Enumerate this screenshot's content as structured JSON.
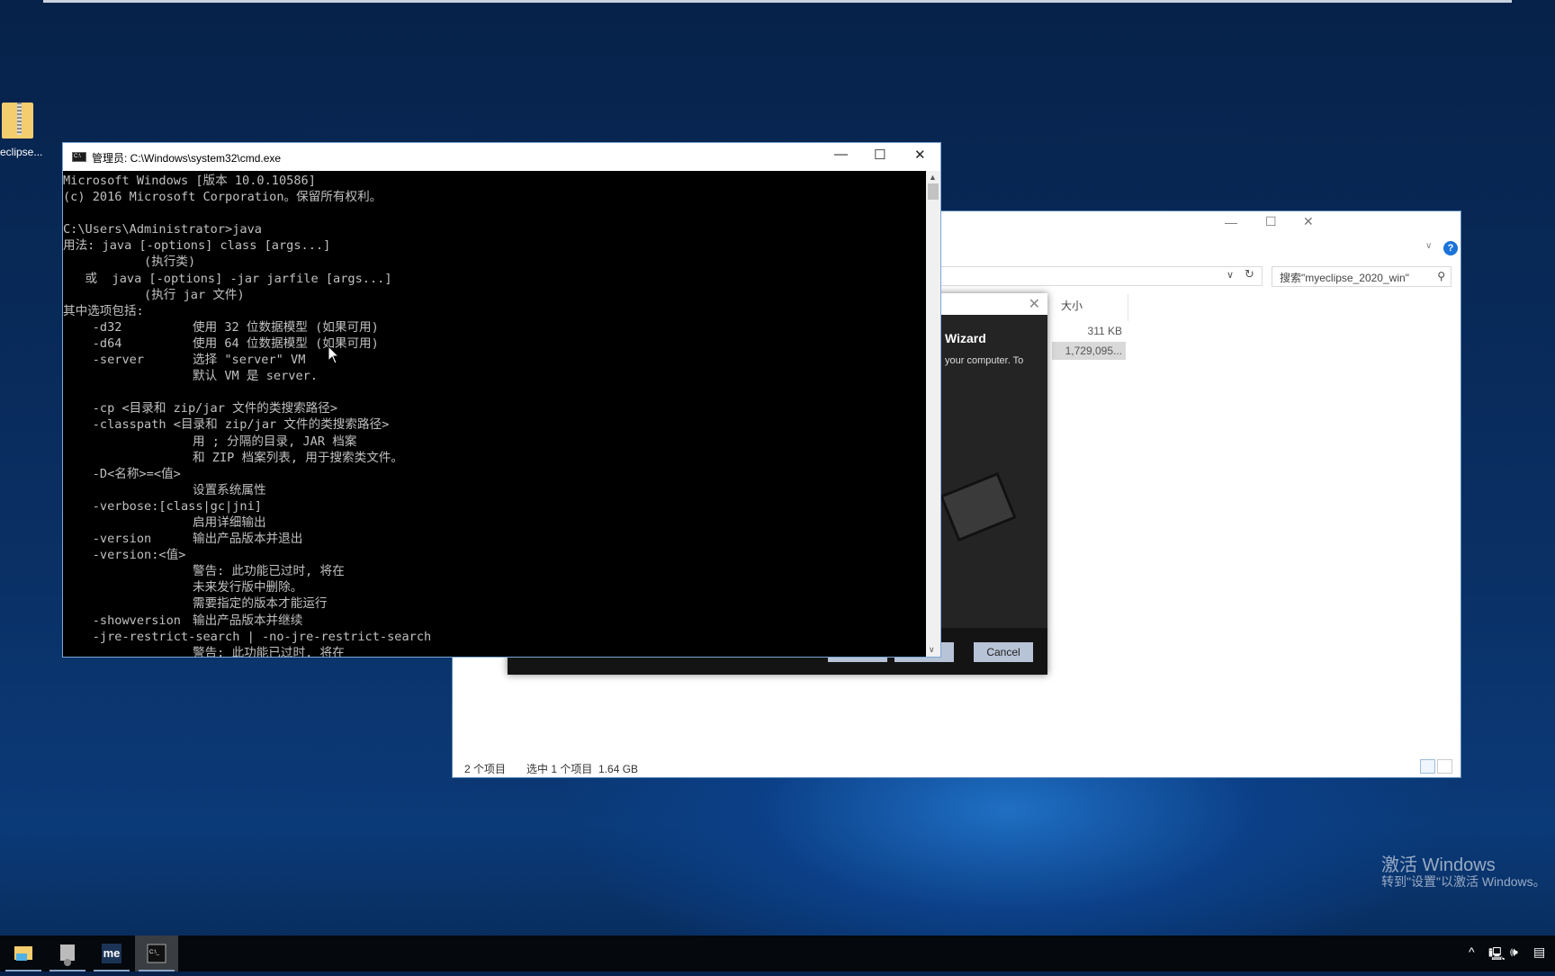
{
  "desktop": {
    "icon_label": "eclipse..."
  },
  "explorer": {
    "search_placeholder": "搜索\"myeclipse_2020_win\"",
    "column_size": "大小",
    "rows": [
      {
        "size": "311 KB"
      },
      {
        "size": "1,729,095..."
      }
    ],
    "status_count": "2 个项目",
    "status_selected": "选中 1 个项目  1.64 GB",
    "help": "?"
  },
  "installer": {
    "heading": "Wizard",
    "text": "your computer. To",
    "cancel": "Cancel"
  },
  "cmd": {
    "title": "管理员: C:\\Windows\\system32\\cmd.exe",
    "lines": [
      {
        "t": "Microsoft Windows [版本 10.0.10586]"
      },
      {
        "t": "(c) 2016 Microsoft Corporation。保留所有权利。"
      },
      {
        "t": ""
      },
      {
        "t": "C:\\Users\\Administrator>java"
      },
      {
        "t": "用法: java [-options] class [args...]"
      },
      {
        "t": "           (执行类)"
      },
      {
        "t": "   或  java [-options] -jar jarfile [args...]"
      },
      {
        "t": "           (执行 jar 文件)"
      },
      {
        "t": "其中选项包括:"
      },
      {
        "t": "    -d32",
        "d": "使用 32 位数据模型 (如果可用)"
      },
      {
        "t": "    -d64",
        "d": "使用 64 位数据模型 (如果可用)"
      },
      {
        "t": "    -server",
        "d": "选择 \"server\" VM"
      },
      {
        "t": "",
        "d": "默认 VM 是 server."
      },
      {
        "t": ""
      },
      {
        "t": "    -cp <目录和 zip/jar 文件的类搜索路径>"
      },
      {
        "t": "    -classpath <目录和 zip/jar 文件的类搜索路径>"
      },
      {
        "t": "",
        "d": "用 ; 分隔的目录, JAR 档案"
      },
      {
        "t": "",
        "d": "和 ZIP 档案列表, 用于搜索类文件。"
      },
      {
        "t": "    -D<名称>=<值>"
      },
      {
        "t": "",
        "d": "设置系统属性"
      },
      {
        "t": "    -verbose:[class|gc|jni]"
      },
      {
        "t": "",
        "d": "启用详细输出"
      },
      {
        "t": "    -version",
        "d": "输出产品版本并退出"
      },
      {
        "t": "    -version:<值>"
      },
      {
        "t": "",
        "d": "警告: 此功能已过时, 将在"
      },
      {
        "t": "",
        "d": "未来发行版中删除。"
      },
      {
        "t": "",
        "d": "需要指定的版本才能运行"
      },
      {
        "t": "    -showversion",
        "d": "输出产品版本并继续"
      },
      {
        "t": "    -jre-restrict-search | -no-jre-restrict-search"
      },
      {
        "t": "",
        "d": "警告: 此功能已过时, 将在"
      }
    ]
  },
  "activation": {
    "title": "激活 Windows",
    "subtitle": "转到\"设置\"以激活 Windows。"
  },
  "taskbar": {
    "me_label": "me"
  }
}
